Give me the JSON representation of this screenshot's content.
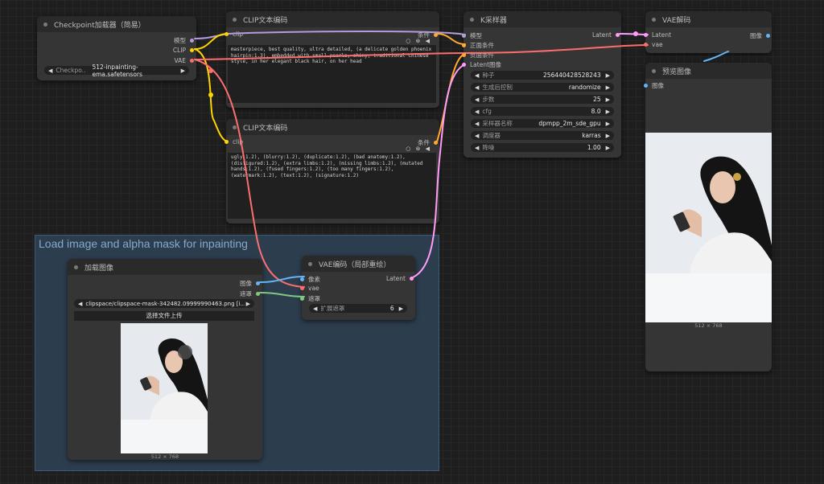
{
  "group": {
    "title": "Load image and alpha mask for inpainting"
  },
  "checkpoint": {
    "title": "Checkpoint加载器（简易）",
    "outputs": [
      "模型",
      "CLIP",
      "VAE"
    ],
    "widget_label": "Checkpo..",
    "widget_value": "512-inpainting-ema.safetensors"
  },
  "clip_pos": {
    "title": "CLIP文本编码",
    "input": "clip",
    "output": "条件",
    "text": "masterpiece, best quality, ultra detailed, (a delicate golden phoenix hairpin:1.3), embedded with small pearls, shiny, traditional Chinese style, in her elegant black hair, on her head"
  },
  "clip_neg": {
    "title": "CLIP文本编码",
    "input": "clip",
    "output": "条件",
    "text": "ugly:1.2), (blurry:1.2), (duplicate:1.2), (bad anatomy:1.2), (disfigured:1.2), (extra limbs:1.2), (missing limbs:1.2), (mutated hands:1.2), (fused fingers:1.2), (too many fingers:1.2), (watermark:1.2), (text:1.2), (signature:1.2)"
  },
  "ksampler": {
    "title": "K采样器",
    "inputs": [
      "模型",
      "正面条件",
      "负面条件",
      "Latent图像"
    ],
    "output": "Latent",
    "widgets": [
      {
        "label": "种子",
        "value": "256440428528243"
      },
      {
        "label": "生成后控制",
        "value": "randomize"
      },
      {
        "label": "步数",
        "value": "25"
      },
      {
        "label": "cfg",
        "value": "8.0"
      },
      {
        "label": "采样器名称",
        "value": "dpmpp_2m_sde_gpu"
      },
      {
        "label": "调度器",
        "value": "karras"
      },
      {
        "label": "降噪",
        "value": "1.00"
      }
    ]
  },
  "vae_decode": {
    "title": "VAE解码",
    "inputs": [
      "Latent",
      "vae"
    ],
    "output": "图像"
  },
  "preview": {
    "title": "预览图像",
    "input": "图像",
    "caption": "512 × 768"
  },
  "load_image": {
    "title": "加载图像",
    "outputs": [
      "图像",
      "遮罩"
    ],
    "file": "clipspace/clipspace-mask-342482.09999990463.png [i...",
    "upload_button": "选择文件上传",
    "caption": "512 × 768"
  },
  "vae_encode": {
    "title": "VAE编码（局部重绘）",
    "inputs": [
      "像素",
      "vae",
      "遮罩"
    ],
    "output": "Latent",
    "widget_label": "扩展遮罩",
    "widget_value": "6"
  },
  "colors": {
    "model": "#b39ddb",
    "clip": "#ffd500",
    "vae": "#ff6e6e",
    "conditioning": "#ffa931",
    "latent": "#ff9cf9",
    "image": "#64b5f6",
    "mask": "#81c784",
    "group_bg": "#2c3d4d"
  }
}
